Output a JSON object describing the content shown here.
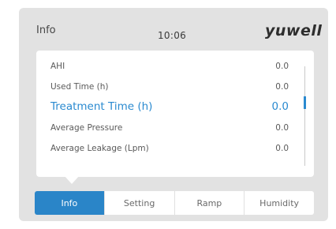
{
  "header": {
    "title": "Info",
    "time": "10:06",
    "brand": "yuwell"
  },
  "rows": [
    {
      "label": "AHI",
      "value": "0.0"
    },
    {
      "label": "Used Time (h)",
      "value": "0.0"
    },
    {
      "label": "Treatment Time (h)",
      "value": "0.0"
    },
    {
      "label": "Average Pressure",
      "value": "0.0"
    },
    {
      "label": "Average Leakage (Lpm)",
      "value": "0.0"
    }
  ],
  "tabs": [
    "Info",
    "Setting",
    "Ramp",
    "Humidity"
  ],
  "colors": {
    "accent": "#2a85c8",
    "background": "#e2e2e2"
  }
}
